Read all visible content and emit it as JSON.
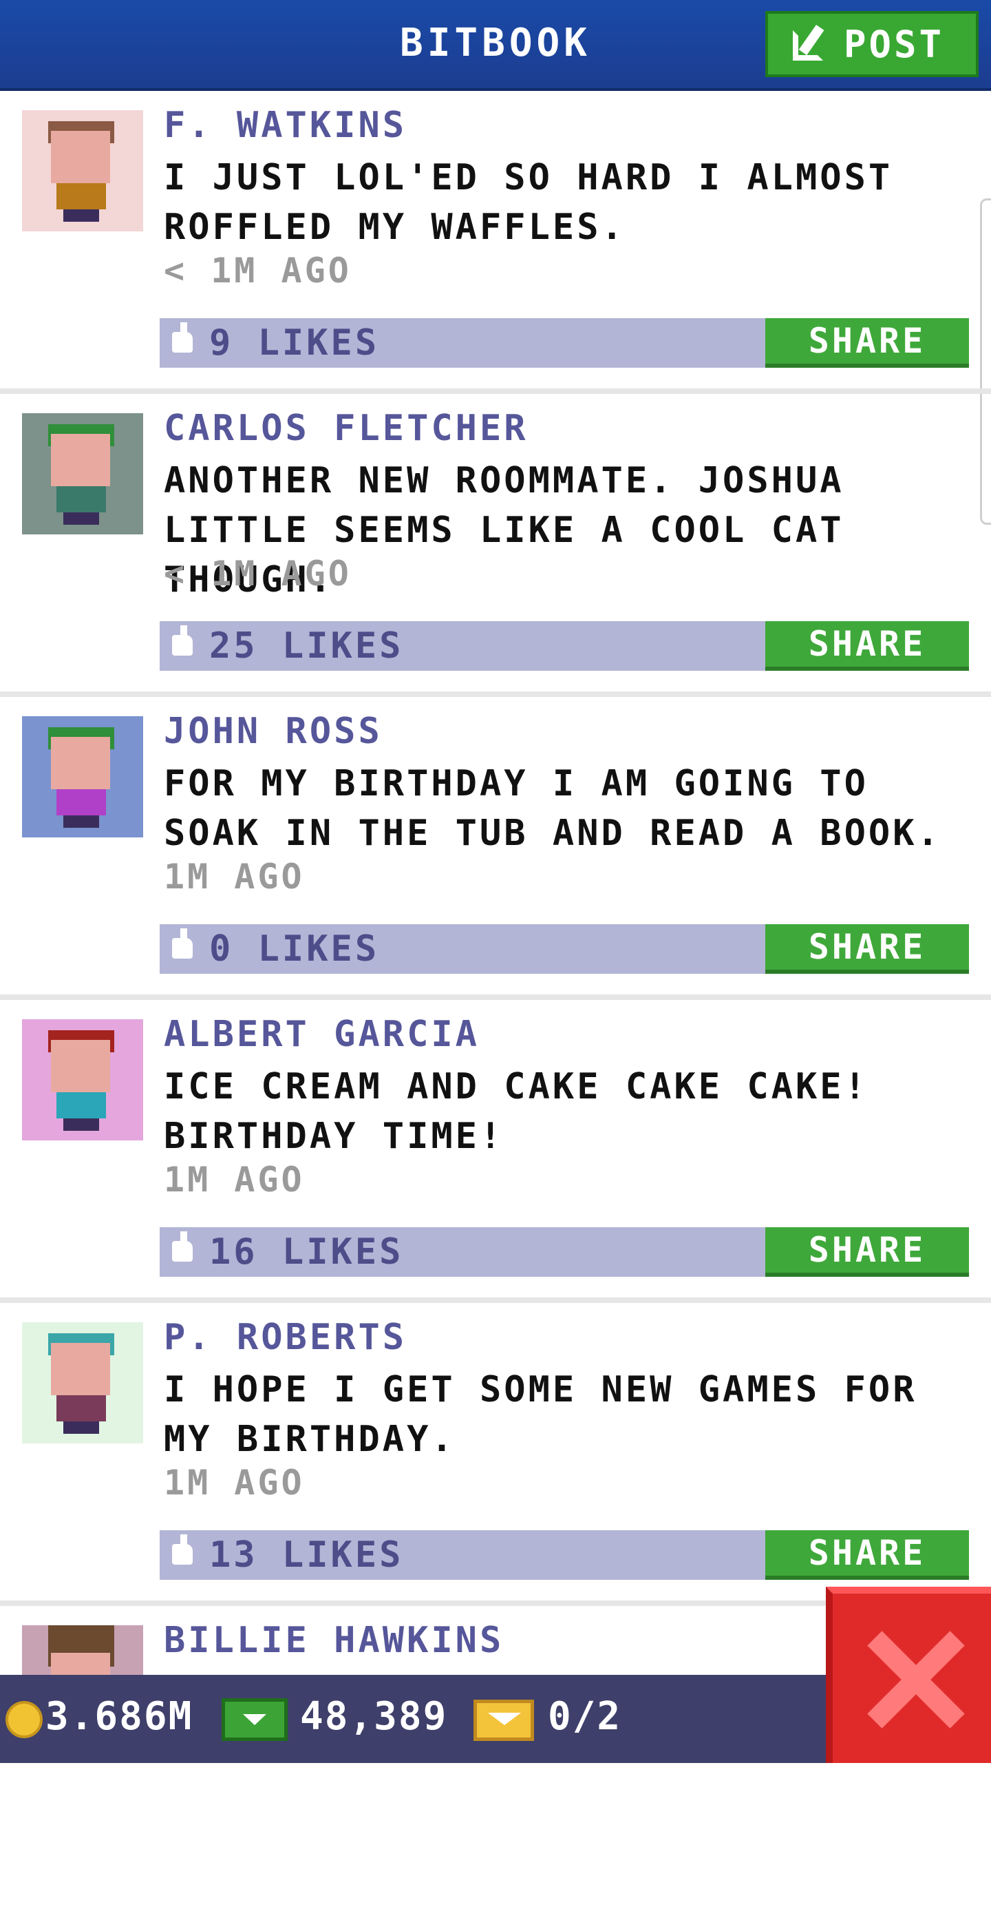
{
  "header": {
    "title": "BITBOOK",
    "post_label": "POST",
    "post_icon": "compose-icon"
  },
  "posts": [
    {
      "name": "F. WATKINS",
      "text": "I JUST LOL'ED SO HARD I ALMOST ROFFLED MY WAFFLES.",
      "time": "< 1M AGO",
      "likes": "9 LIKES",
      "share_label": "SHARE",
      "avatar_bg": "#f3d6d6",
      "hair_color": "#8a5a45",
      "body_color": "#b87a1a"
    },
    {
      "name": "CARLOS FLETCHER",
      "text": "ANOTHER NEW ROOMMATE. JOSHUA LITTLE SEEMS LIKE A COOL CAT THOUGH.",
      "time": "< 1M AGO",
      "likes": "25 LIKES",
      "share_label": "SHARE",
      "avatar_bg": "#7d928a",
      "hair_color": "#2f8f3a",
      "body_color": "#3a7a6a"
    },
    {
      "name": "JOHN ROSS",
      "text": "FOR MY BIRTHDAY I AM GOING TO SOAK IN THE TUB AND READ A BOOK.",
      "time": "1M AGO",
      "likes": "0 LIKES",
      "share_label": "SHARE",
      "avatar_bg": "#7b93cf",
      "hair_color": "#2f8f3a",
      "body_color": "#b040c8"
    },
    {
      "name": "ALBERT GARCIA",
      "text": "ICE CREAM AND CAKE CAKE CAKE! BIRTHDAY TIME!",
      "time": "1M AGO",
      "likes": "16 LIKES",
      "share_label": "SHARE",
      "avatar_bg": "#e4a6dc",
      "hair_color": "#a3231e",
      "body_color": "#2aa6b8"
    },
    {
      "name": "P. ROBERTS",
      "text": "I HOPE I GET SOME NEW GAMES FOR MY BIRTHDAY.",
      "time": "1M AGO",
      "likes": "13 LIKES",
      "share_label": "SHARE",
      "avatar_bg": "#e2f5e3",
      "hair_color": "#3aa6a8",
      "body_color": "#7a3b5a"
    },
    {
      "name": "BILLIE HAWKINS",
      "text": "",
      "time": "",
      "likes": "",
      "share_label": "",
      "avatar_bg": "#c7a2b3",
      "hair_color": "#6b4a2f",
      "body_color": "#c060c0"
    }
  ],
  "status": {
    "coins": "3.686M",
    "cash": "48,389",
    "tickets": "0/2"
  },
  "colors": {
    "header_blue": "#1a4aa8",
    "accent_green": "#3fa83a",
    "name_purple": "#56569a",
    "like_bar": "#b3b5d6",
    "close_red": "#e02a2a"
  }
}
